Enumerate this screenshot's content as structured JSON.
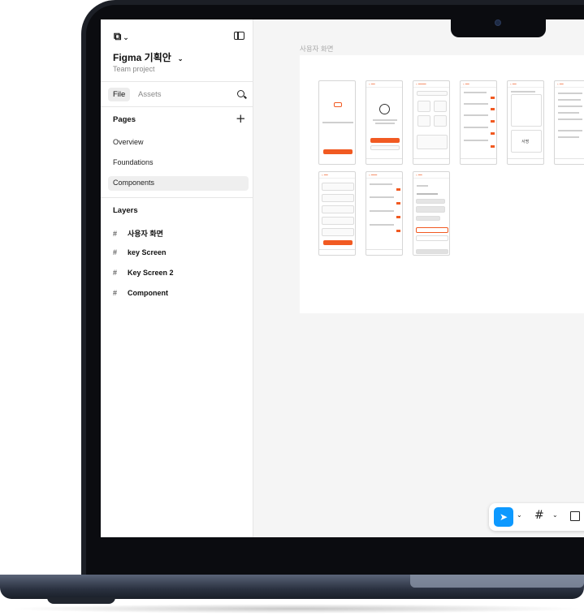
{
  "sidebar": {
    "file_name": "Figma 기획안",
    "team": "Team project",
    "tabs": [
      {
        "label": "File"
      },
      {
        "label": "Assets"
      }
    ],
    "pages_title": "Pages",
    "pages": [
      {
        "label": "Overview"
      },
      {
        "label": "Foundations"
      },
      {
        "label": "Components"
      }
    ],
    "layers_title": "Layers",
    "layers": [
      {
        "label": "사용자 화면"
      },
      {
        "label": "key Screen"
      },
      {
        "label": "Key Screen 2"
      },
      {
        "label": "Component"
      }
    ]
  },
  "canvas": {
    "frame_title": "사용자 화면",
    "phone_texts": {
      "sign_label": "서명"
    }
  },
  "toolbar": {
    "tools": [
      "move-tool",
      "frame-tool",
      "rectangle-tool"
    ]
  },
  "colors": {
    "accent": "#f15a22",
    "selection": "#0d99ff",
    "laptop": "#1c1f26"
  }
}
